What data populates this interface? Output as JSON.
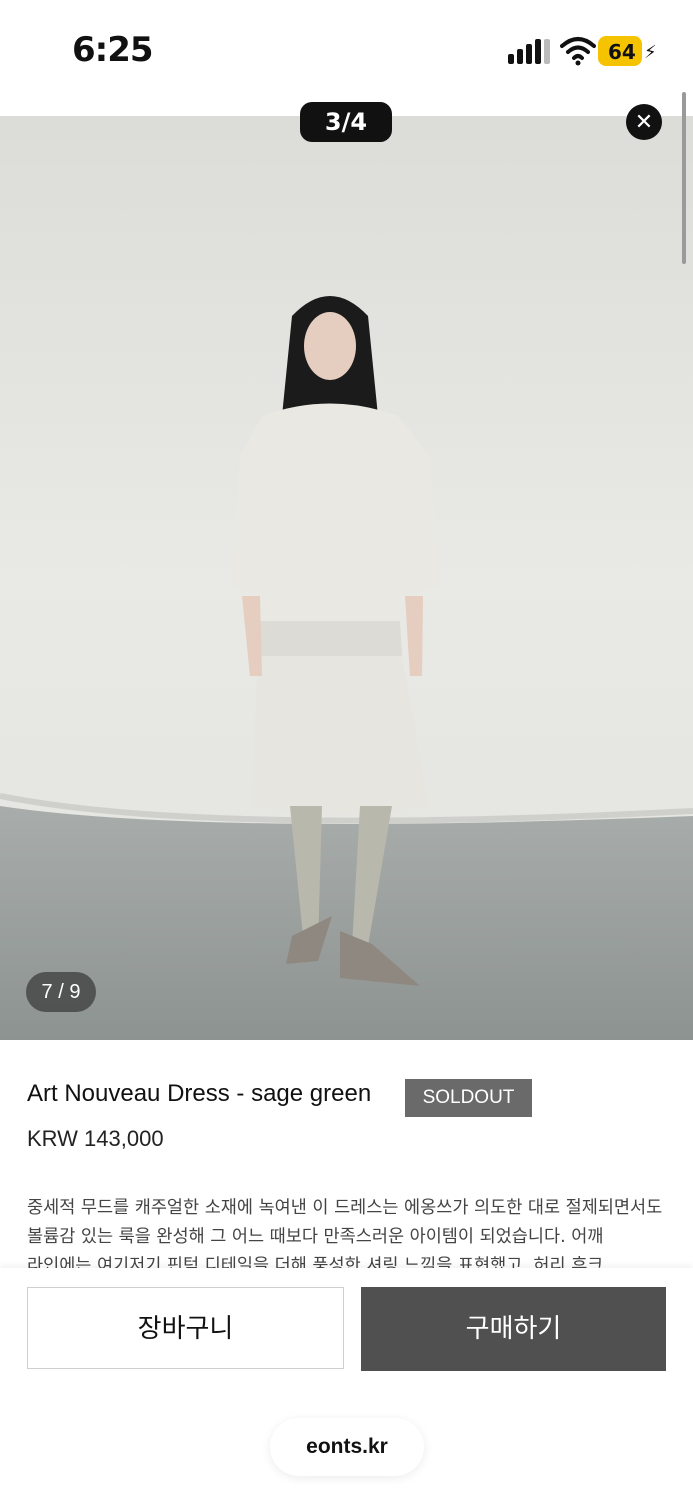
{
  "status_bar": {
    "time": "6:25",
    "battery": "64",
    "icons": [
      "signal-icon",
      "wifi-icon",
      "battery-icon"
    ]
  },
  "gallery": {
    "counter": "3/4",
    "photo_counter": "7 / 9",
    "close_icon": "close-icon"
  },
  "product": {
    "title": "Art Nouveau Dress - sage green",
    "badge": "SOLDOUT",
    "price": "KRW 143,000",
    "description": "중세적 무드를 캐주얼한 소재에 녹여낸 이 드레스는 에옹쓰가 의도한 대로 절제되면서도 볼륨감 있는 룩을 완성해 그 어느 때보다 만족스러운 아이템이 되었습니다. 어깨 라인에는 여기저기 핀턱 디테일을 더해 풍성한 셔링 느낌을 표현했고, 허리 후크"
  },
  "actions": {
    "cart_label": "장바구니",
    "buy_label": "구매하기"
  },
  "browser": {
    "url": "eonts.kr"
  },
  "colors": {
    "badge_bg": "#6a6a6a",
    "buy_bg": "#505050",
    "battery": "#f5c300"
  }
}
